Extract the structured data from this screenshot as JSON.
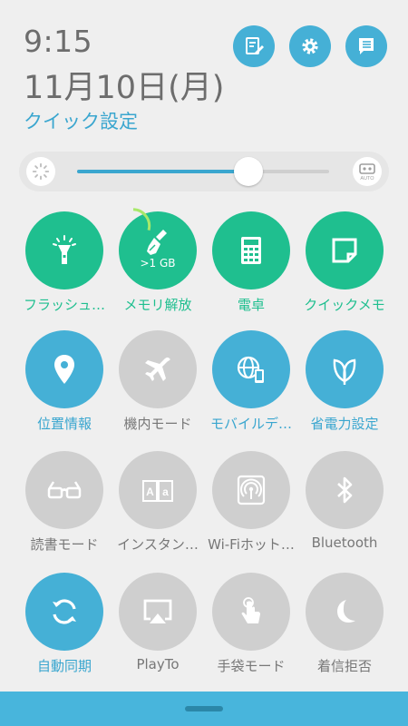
{
  "header": {
    "time": "9:15",
    "date": "11月10日(月)",
    "title": "クイック設定",
    "buttons": [
      {
        "icon": "edit-note-icon"
      },
      {
        "icon": "gear-icon"
      },
      {
        "icon": "notification-list-icon"
      }
    ]
  },
  "brightness": {
    "level": 0.68,
    "left_icon": "brightness-icon",
    "right_icon": "auto-brightness-icon",
    "auto_label": "AUTO"
  },
  "tiles": [
    {
      "label": "フラッシュ…",
      "icon": "flashlight-icon",
      "state": "on-green"
    },
    {
      "label": "メモリ解放",
      "icon": "broom-icon",
      "state": "on-green",
      "memory_text": ">1 GB"
    },
    {
      "label": "電卓",
      "icon": "calculator-icon",
      "state": "on-green"
    },
    {
      "label": "クイックメモ",
      "icon": "note-icon",
      "state": "on-green"
    },
    {
      "label": "位置情報",
      "icon": "location-icon",
      "state": "on-blue"
    },
    {
      "label": "機内モード",
      "icon": "airplane-icon",
      "state": "off"
    },
    {
      "label": "モバイルデ…",
      "icon": "mobile-data-icon",
      "state": "on-blue"
    },
    {
      "label": "省電力設定",
      "icon": "leaf-icon",
      "state": "on-blue"
    },
    {
      "label": "読書モード",
      "icon": "glasses-icon",
      "state": "off"
    },
    {
      "label": "インスタン…",
      "icon": "dictionary-icon",
      "state": "off"
    },
    {
      "label": "Wi-Fiホット…",
      "icon": "hotspot-icon",
      "state": "off"
    },
    {
      "label": "Bluetooth",
      "icon": "bluetooth-icon",
      "state": "off"
    },
    {
      "label": "自動同期",
      "icon": "sync-icon",
      "state": "on-blue"
    },
    {
      "label": "PlayTo",
      "icon": "cast-icon",
      "state": "off"
    },
    {
      "label": "手袋モード",
      "icon": "touch-icon",
      "state": "off"
    },
    {
      "label": "着信拒否",
      "icon": "moon-icon",
      "state": "off"
    }
  ],
  "colors": {
    "green": "#1fbf8f",
    "blue": "#45b0d6",
    "gray": "#cfcfcf",
    "bar": "#48b5dc"
  }
}
